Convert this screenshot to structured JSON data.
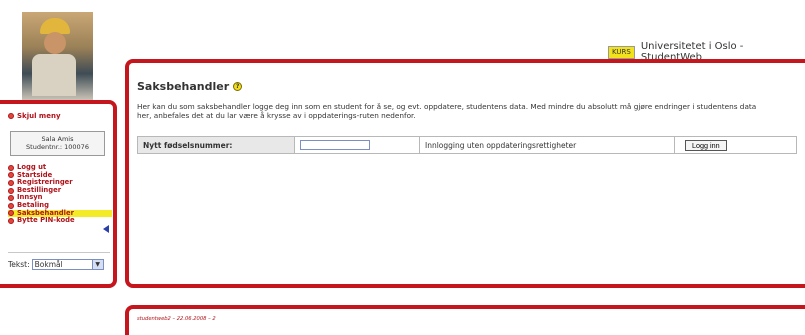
{
  "header": {
    "badge": "KURS",
    "title": "Universitetet i Oslo - StudentWeb"
  },
  "sidebar": {
    "hide_menu": "Skjul meny",
    "user_name": "Sala Amis",
    "user_number": "Studentnr.: 100076",
    "items": [
      {
        "label": "Logg ut"
      },
      {
        "label": "Startside"
      },
      {
        "label": "Registreringer"
      },
      {
        "label": "Bestillinger"
      },
      {
        "label": "Innsyn"
      },
      {
        "label": "Betaling"
      },
      {
        "label": "Saksbehandler",
        "active": true
      },
      {
        "label": "Bytte PIN-kode"
      }
    ],
    "language_label": "Tekst:",
    "language_value": "Bokmål"
  },
  "main": {
    "title": "Saksbehandler",
    "intro_line1": "Her kan du som saksbehandler logge deg inn som en student for å se, og evt. oppdatere, studentens data. Med mindre du absolutt må gjøre endringer i studentens data",
    "intro_line2": "her, anbefales det at du lar være å krysse av i oppdaterings-ruten nedenfor.",
    "form": {
      "label": "Nytt fødselsnummer:",
      "input_value": "",
      "option_label": "Innlogging uten oppdateringsrettigheter",
      "button_label": "Logg inn"
    }
  },
  "footer": {
    "text": "studentweb2 – 22.06.2008 – 2"
  },
  "colors": {
    "accent": "#c4161c",
    "highlight": "#f3ea28"
  }
}
